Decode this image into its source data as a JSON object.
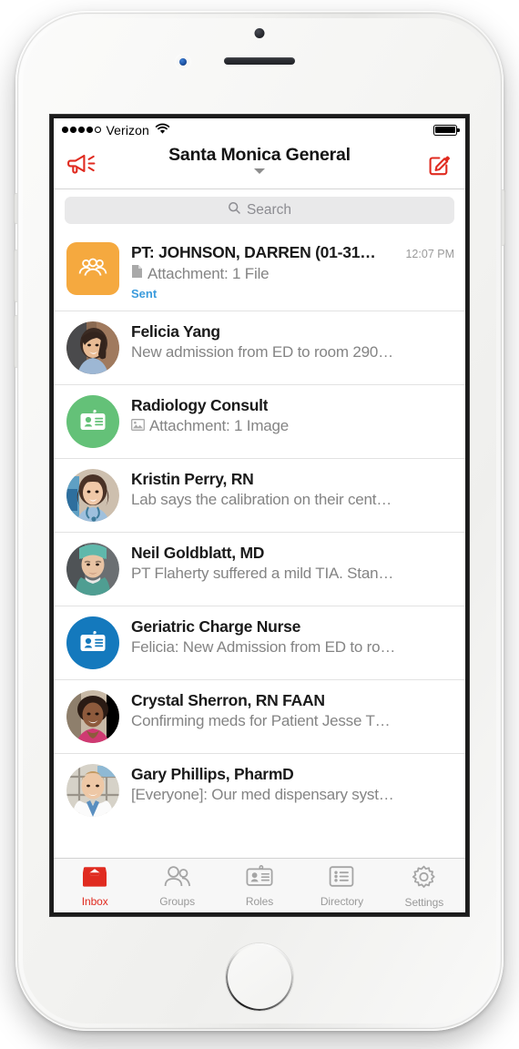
{
  "status_bar": {
    "signal_dots_filled": 4,
    "signal_dots_total": 5,
    "carrier": "Verizon",
    "wifi_icon": "wifi-icon",
    "battery_icon": "battery-full-icon",
    "battery_level": 100
  },
  "nav": {
    "broadcast_icon": "megaphone-icon",
    "title": "Santa Monica General",
    "caret_icon": "chevron-down-icon",
    "compose_icon": "compose-icon",
    "accent_color": "#e02b20"
  },
  "search": {
    "icon": "search-icon",
    "placeholder": "Search"
  },
  "messages": [
    {
      "avatar_type": "group-square",
      "avatar_icon": "group-icon",
      "avatar_color": "#f5a93f",
      "name": "PT: JOHNSON, DARREN (01-31…",
      "time": "12:07 PM",
      "preview_icon": "file-attachment-icon",
      "preview": "Attachment: 1 File",
      "status": "Sent",
      "status_color": "#3a9bdc"
    },
    {
      "avatar_type": "photo",
      "avatar_icon": "avatar-photo-felicia",
      "name": "Felicia Yang",
      "time": "",
      "preview_icon": "",
      "preview": "New admission from ED to room 290…",
      "status": ""
    },
    {
      "avatar_type": "role-circle",
      "avatar_icon": "id-badge-icon",
      "avatar_color": "#64c178",
      "name": "Radiology Consult",
      "time": "",
      "preview_icon": "image-attachment-icon",
      "preview": "Attachment: 1 Image",
      "status": ""
    },
    {
      "avatar_type": "photo",
      "avatar_icon": "avatar-photo-kristin",
      "name": "Kristin Perry, RN",
      "time": "",
      "preview_icon": "",
      "preview": "Lab says the calibration on their cent…",
      "status": ""
    },
    {
      "avatar_type": "photo",
      "avatar_icon": "avatar-photo-neil",
      "name": "Neil Goldblatt, MD",
      "time": "",
      "preview_icon": "",
      "preview": "PT Flaherty suffered a mild TIA. Stan…",
      "status": ""
    },
    {
      "avatar_type": "role-circle",
      "avatar_icon": "id-badge-icon",
      "avatar_color": "#1479bd",
      "name": "Geriatric Charge Nurse",
      "time": "",
      "preview_icon": "",
      "preview": "Felicia: New Admission from ED to ro…",
      "status": ""
    },
    {
      "avatar_type": "photo",
      "avatar_icon": "avatar-photo-crystal",
      "name": "Crystal Sherron, RN FAAN",
      "time": "",
      "preview_icon": "",
      "preview": "Confirming meds for Patient Jesse T…",
      "status": ""
    },
    {
      "avatar_type": "photo",
      "avatar_icon": "avatar-photo-gary",
      "name": "Gary Phillips, PharmD",
      "time": "",
      "preview_icon": "",
      "preview": "[Everyone]: Our med dispensary syst…",
      "status": ""
    }
  ],
  "tabs": [
    {
      "label": "Inbox",
      "icon": "inbox-icon",
      "active": true
    },
    {
      "label": "Groups",
      "icon": "groups-icon",
      "active": false
    },
    {
      "label": "Roles",
      "icon": "roles-icon",
      "active": false
    },
    {
      "label": "Directory",
      "icon": "directory-icon",
      "active": false
    },
    {
      "label": "Settings",
      "icon": "settings-icon",
      "active": false
    }
  ]
}
